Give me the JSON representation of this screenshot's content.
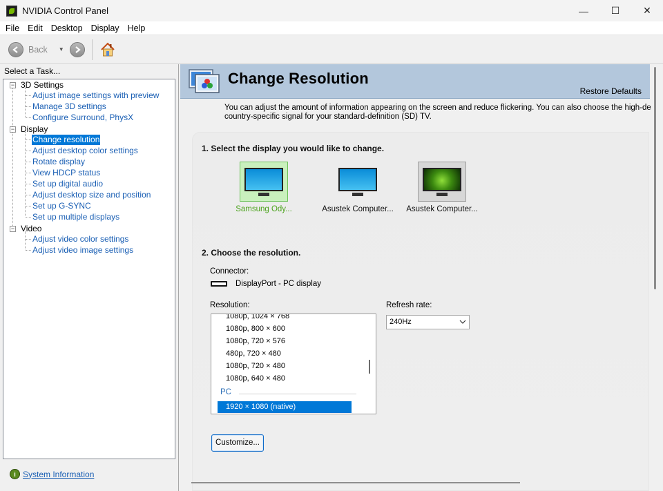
{
  "window": {
    "title": "NVIDIA Control Panel",
    "controls": [
      "—",
      "☐",
      "✕"
    ]
  },
  "menu": [
    "File",
    "Edit",
    "Desktop",
    "Display",
    "Help"
  ],
  "toolbar": {
    "back_label": "Back"
  },
  "left_panel": {
    "select_task_label": "Select a Task...",
    "tree": [
      {
        "category": "3D Settings",
        "items": [
          "Adjust image settings with preview",
          "Manage 3D settings",
          "Configure Surround, PhysX"
        ]
      },
      {
        "category": "Display",
        "items": [
          "Change resolution",
          "Adjust desktop color settings",
          "Rotate display",
          "View HDCP status",
          "Set up digital audio",
          "Adjust desktop size and position",
          "Set up G-SYNC",
          "Set up multiple displays"
        ]
      },
      {
        "category": "Video",
        "items": [
          "Adjust video color settings",
          "Adjust video image settings"
        ]
      }
    ],
    "selected_item": "Change resolution",
    "system_info_label": "System Information"
  },
  "page": {
    "title": "Change Resolution",
    "restore_defaults": "Restore Defaults",
    "description_line1": "You can adjust the amount of information appearing on the screen and reduce flickering. You can also choose the high-definition (H",
    "description_line2": "country-specific signal for your standard-definition (SD) TV.",
    "section1_title": "1. Select the display you would like to change.",
    "displays": [
      {
        "label": "Samsung Ody...",
        "selected": true,
        "screen": "blue"
      },
      {
        "label": "Asustek Computer...",
        "selected": false,
        "screen": "blue"
      },
      {
        "label": "Asustek Computer...",
        "selected": false,
        "screen": "nvidia"
      }
    ],
    "section2_title": "2. Choose the resolution.",
    "connector_label": "Connector:",
    "connector_value": "DisplayPort - PC display",
    "resolution_label": "Resolution:",
    "resolutions": [
      "1080p, 1024 × 768",
      "1080p, 800 × 600",
      "1080p, 720 × 576",
      "480p, 720 × 480",
      "1080p, 720 × 480",
      "1080p, 640 × 480"
    ],
    "resolution_group": "PC",
    "selected_resolution": "1920 × 1080 (native)",
    "refresh_label": "Refresh rate:",
    "refresh_value": "240Hz",
    "customize_label": "Customize..."
  },
  "colors": {
    "accent": "#0078d7",
    "header_bg": "#b3c7dc",
    "link": "#1a5fb4",
    "nvidia_green": "#76b900"
  }
}
